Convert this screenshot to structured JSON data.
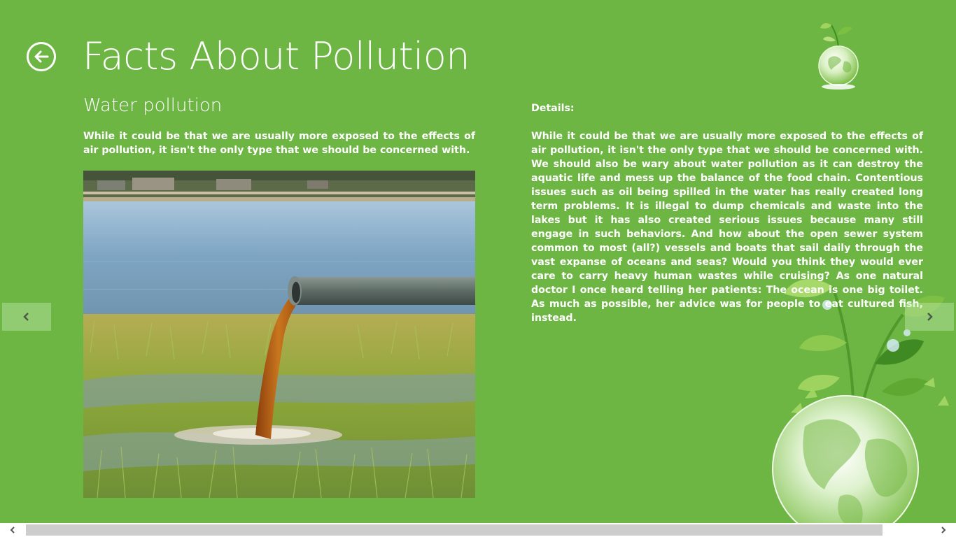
{
  "header": {
    "title": "Facts About Pollution"
  },
  "section": {
    "title": "Water pollution",
    "summary": "While it could be that we are usually more exposed to the effects of air pollution, it isn't the only type that we should be concerned with."
  },
  "details": {
    "label": "Details:",
    "text": "While it could be that we are usually more exposed to the effects of air pollution, it isn't the only type that we should be concerned with. We should also be wary about water pollution as it can destroy the aquatic life and mess up the balance of the food chain. Contentious issues such as oil being spilled in the water has really created long term problems. It is illegal to dump chemicals and waste into the lakes but it has also created serious issues because many still engage in such behaviors. And how about the open sewer system common to most (all?) vessels and boats that sail daily through the vast expanse of oceans and seas? Would you think they would ever care to carry heavy human wastes while cruising? As one natural doctor I once heard telling her patients: The ocean is one big toilet. As much as possible, her advice was for people to eat cultured fish, instead."
  },
  "icons": {
    "back": "back-arrow-icon",
    "prev": "chevron-left-icon",
    "next": "chevron-right-icon",
    "logo": "green-globe-logo",
    "decoration": "plant-globe-decoration"
  },
  "colors": {
    "background": "#6db644",
    "text": "#ffffff",
    "scroll_thumb": "#cdcdcd"
  }
}
